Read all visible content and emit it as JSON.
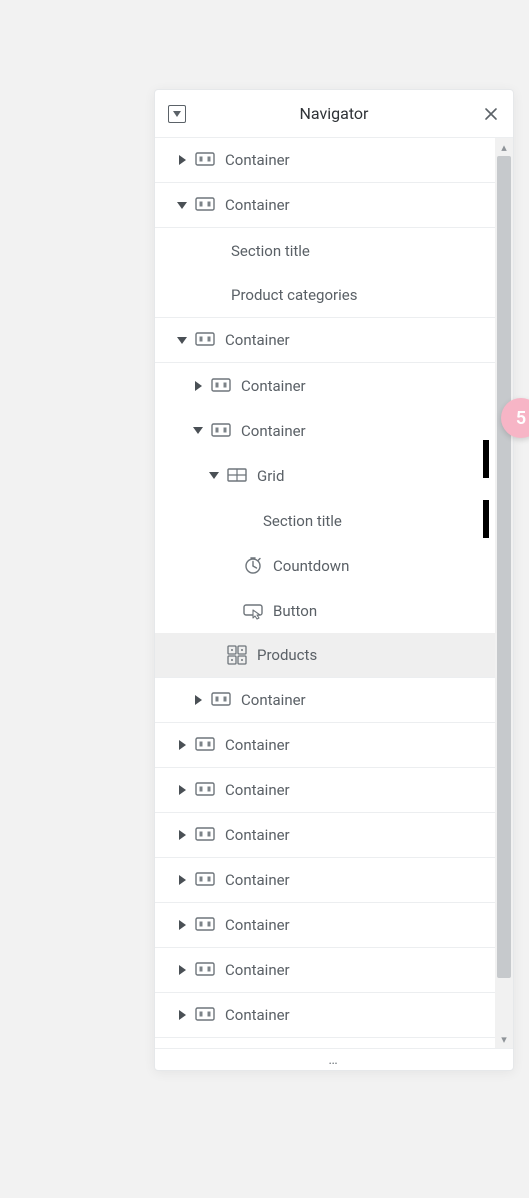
{
  "header": {
    "title": "Navigator"
  },
  "badge": {
    "text": "5"
  },
  "footer": {
    "dots": "…"
  },
  "tree": [
    {
      "depth": 0,
      "toggle": "right",
      "icon": "container",
      "label": "Container"
    },
    {
      "depth": 0,
      "toggle": "down",
      "icon": "container",
      "label": "Container"
    },
    {
      "depth": 1,
      "toggle": "none",
      "icon": "none",
      "label": "Section title"
    },
    {
      "depth": 1,
      "toggle": "none",
      "icon": "none",
      "label": "Product categories"
    },
    {
      "depth": 0,
      "toggle": "down",
      "icon": "container",
      "label": "Container"
    },
    {
      "depth": 1,
      "toggle": "right",
      "icon": "container",
      "label": "Container"
    },
    {
      "depth": 1,
      "toggle": "down",
      "icon": "container",
      "label": "Container"
    },
    {
      "depth": 2,
      "toggle": "down",
      "icon": "grid",
      "label": "Grid"
    },
    {
      "depth": 3,
      "toggle": "none",
      "icon": "none",
      "label": "Section title"
    },
    {
      "depth": 3,
      "toggle": "none",
      "icon": "countdown",
      "label": "Countdown"
    },
    {
      "depth": 3,
      "toggle": "none",
      "icon": "button",
      "label": "Button"
    },
    {
      "depth": 2,
      "toggle": "none",
      "icon": "products",
      "label": "Products",
      "selected": true
    },
    {
      "depth": 1,
      "toggle": "right",
      "icon": "container",
      "label": "Container"
    },
    {
      "depth": 0,
      "toggle": "right",
      "icon": "container",
      "label": "Container"
    },
    {
      "depth": 0,
      "toggle": "right",
      "icon": "container",
      "label": "Container"
    },
    {
      "depth": 0,
      "toggle": "right",
      "icon": "container",
      "label": "Container"
    },
    {
      "depth": 0,
      "toggle": "right",
      "icon": "container",
      "label": "Container"
    },
    {
      "depth": 0,
      "toggle": "right",
      "icon": "container",
      "label": "Container"
    },
    {
      "depth": 0,
      "toggle": "right",
      "icon": "container",
      "label": "Container"
    },
    {
      "depth": 0,
      "toggle": "right",
      "icon": "container",
      "label": "Container"
    }
  ]
}
